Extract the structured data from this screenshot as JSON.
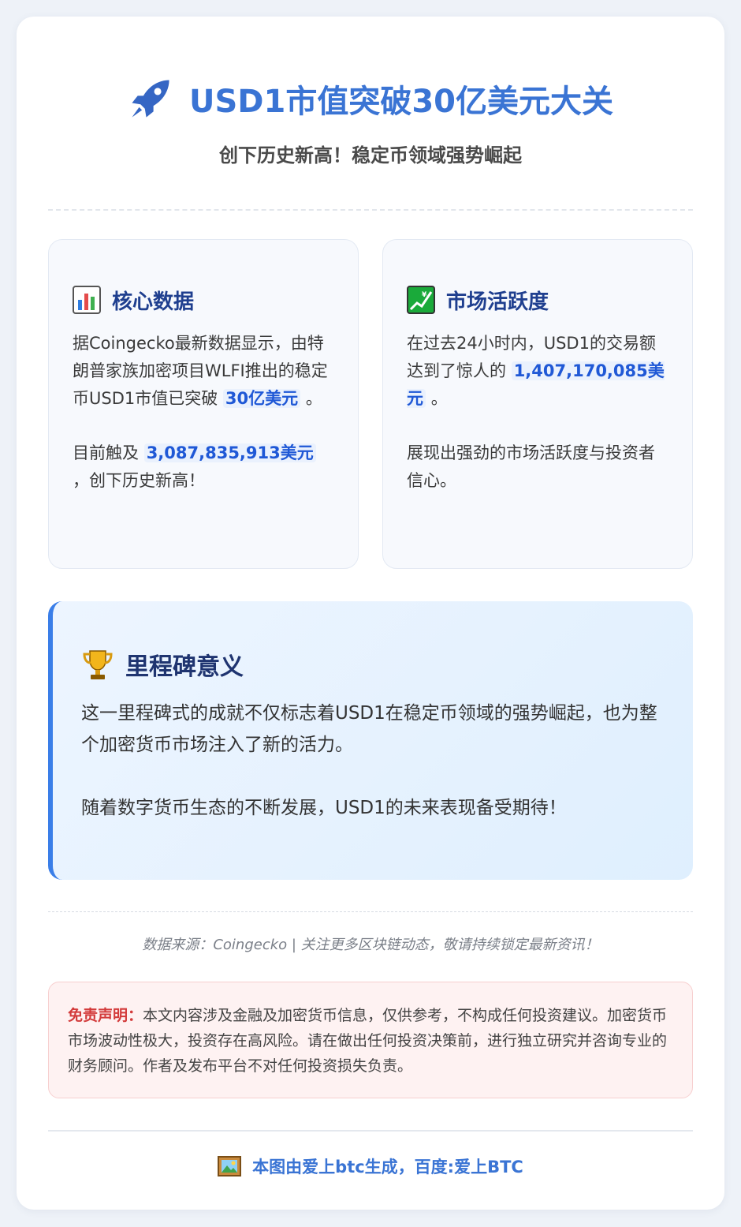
{
  "header": {
    "icon": "rocket-icon",
    "title": "USD1市值突破30亿美元大关",
    "subtitle": "创下历史新高！稳定币领域强势崛起"
  },
  "core_data": {
    "icon": "bar-chart-icon",
    "heading": "核心数据",
    "p1_before": "据Coingecko最新数据显示，由特朗普家族加密项目WLFI推出的稳定币USD1市值已突破",
    "p1_highlight": "30亿美元",
    "p1_after": "。",
    "p2_before": "目前触及",
    "p2_highlight": "3,087,835,913美元",
    "p2_after": "，创下历史新高！"
  },
  "market_activity": {
    "icon": "trend-up-chart-icon",
    "heading": "市场活跃度",
    "p1_before": "在过去24小时内，USD1的交易额达到了惊人的",
    "p1_highlight": "1,407,170,085美元",
    "p1_after": "。",
    "p2": "展现出强劲的市场活跃度与投资者信心。"
  },
  "milestone": {
    "icon": "trophy-icon",
    "heading": "里程碑意义",
    "p1": "这一里程碑式的成就不仅标志着USD1在稳定币领域的强势崛起，也为整个加密货币市场注入了新的活力。",
    "p2": "随着数字货币生态的不断发展，USD1的未来表现备受期待！"
  },
  "source": {
    "text": "数据来源：Coingecko | 关注更多区块链动态，敬请持续锁定最新资讯！"
  },
  "disclaimer": {
    "label": "免责声明：",
    "text": "本文内容涉及金融及加密货币信息，仅供参考，不构成任何投资建议。加密货币市场波动性极大，投资存在高风险。请在做出任何投资决策前，进行独立研究并咨询专业的财务顾问。作者及发布平台不对任何投资损失负责。"
  },
  "footer": {
    "icon": "framed-picture-icon",
    "text": "本图由爱上btc生成，百度:爱上BTC"
  },
  "colors": {
    "accent": "#3a74d4",
    "heading": "#1f3f8f",
    "highlight": "#1f58d6",
    "milestone_border": "#3a7ee8",
    "disclaimer_label": "#d33b3b"
  }
}
